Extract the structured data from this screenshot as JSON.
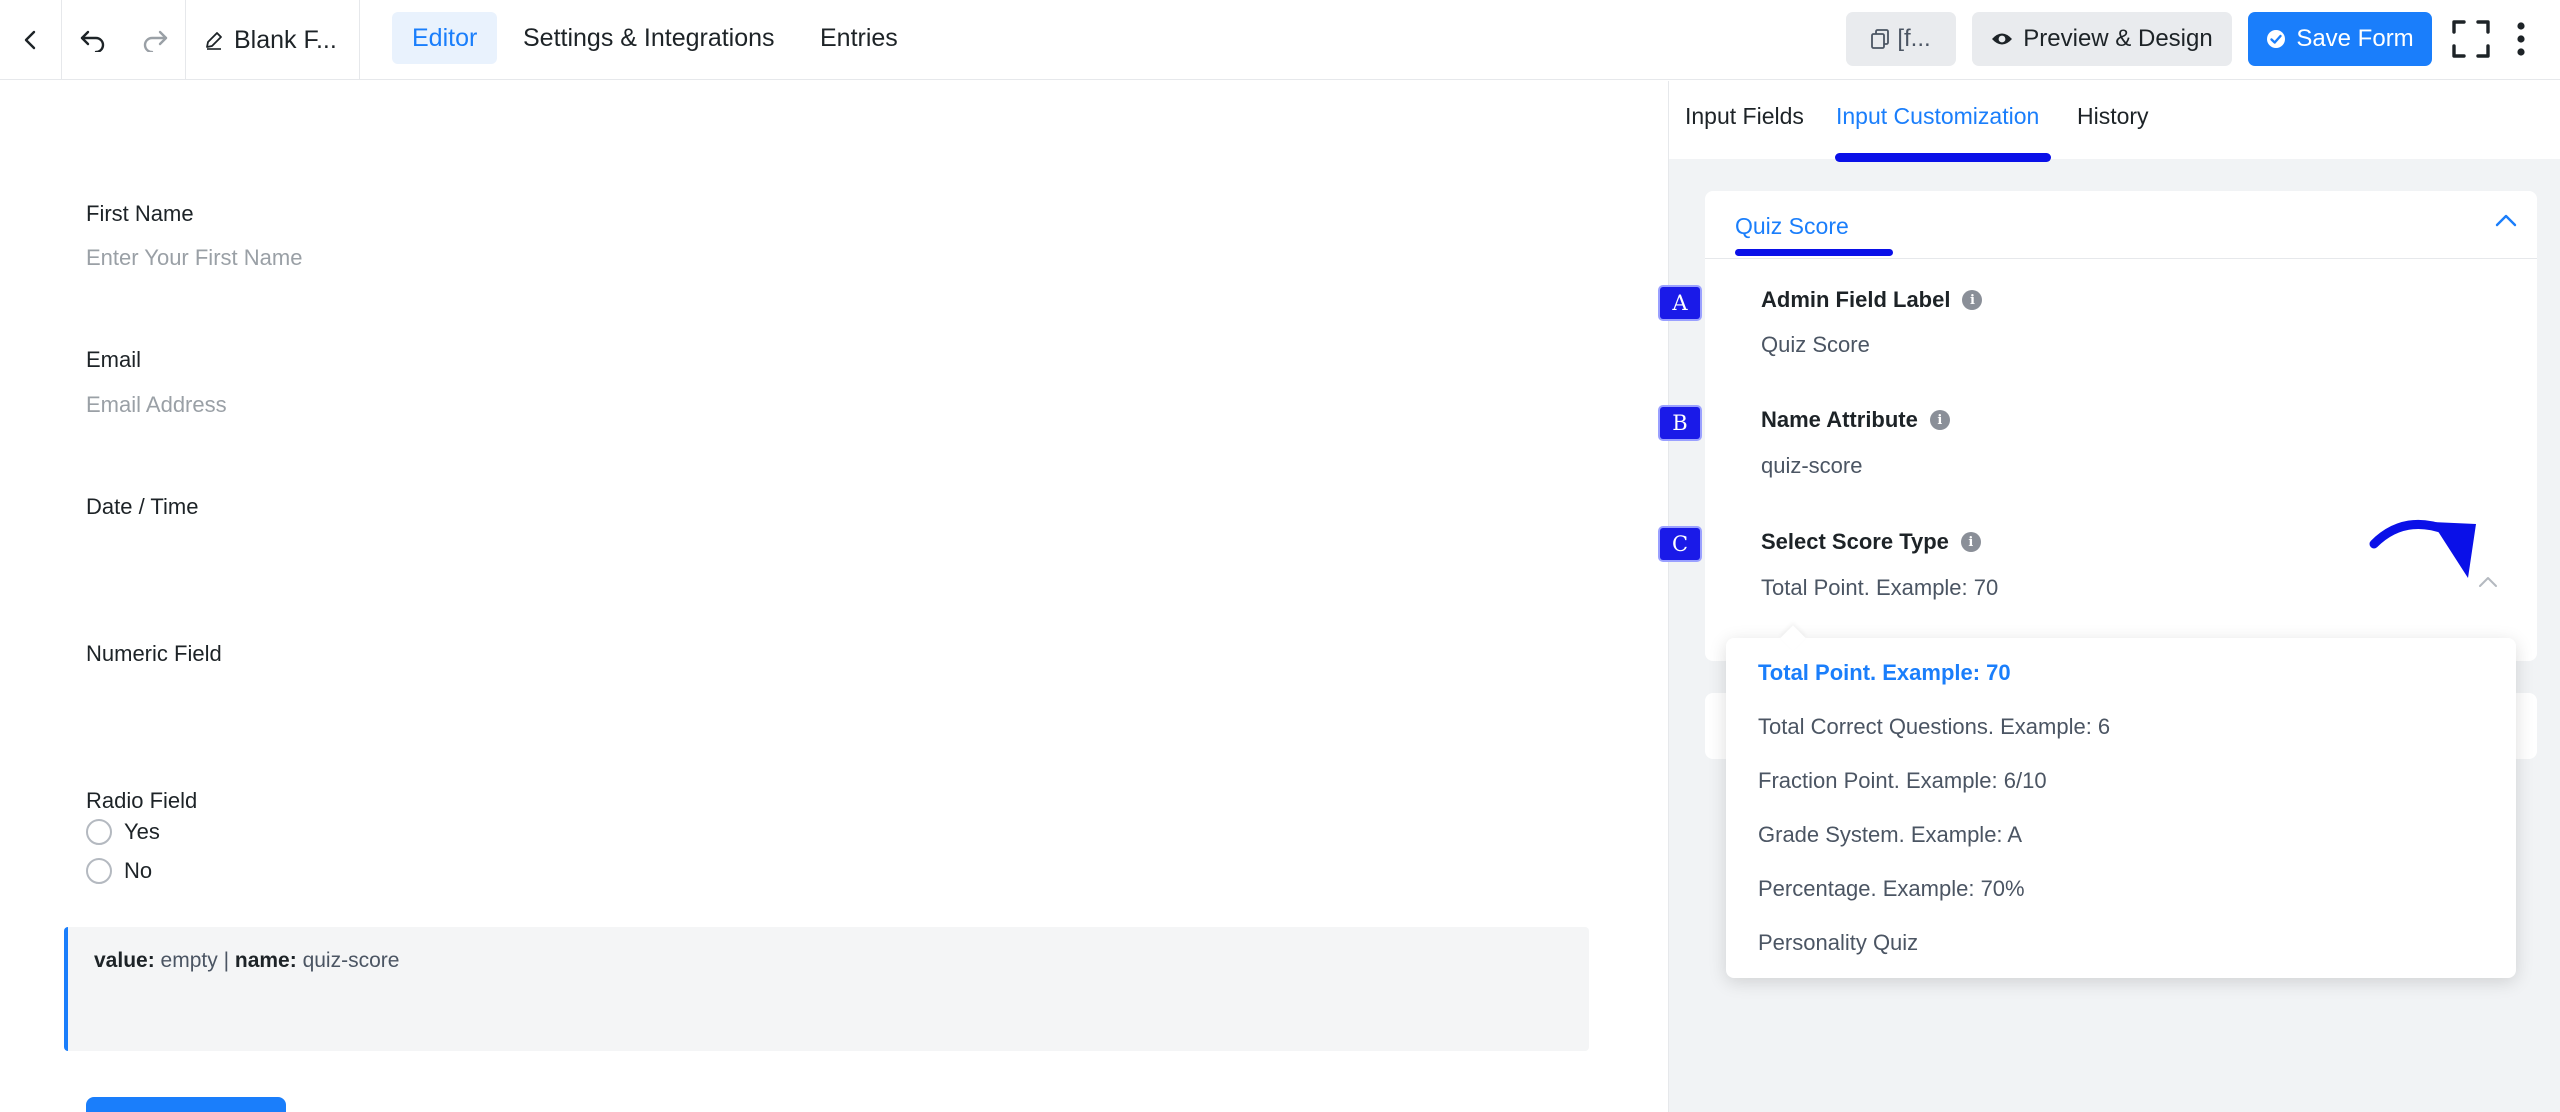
{
  "topbar": {
    "form_title": "Blank F...",
    "tabs": [
      {
        "label": "Editor",
        "active": true
      },
      {
        "label": "Settings & Integrations",
        "active": false
      },
      {
        "label": "Entries",
        "active": false
      }
    ],
    "shortcode_label": "[f...",
    "preview_label": "Preview & Design",
    "save_label": "Save Form"
  },
  "editor": {
    "fields": [
      {
        "label": "First Name",
        "placeholder": "Enter Your First Name"
      },
      {
        "label": "Email",
        "placeholder": "Email Address"
      },
      {
        "label": "Date / Time",
        "placeholder": ""
      },
      {
        "label": "Numeric Field",
        "placeholder": ""
      },
      {
        "label": "Radio Field",
        "placeholder": ""
      }
    ],
    "radio_options": [
      "Yes",
      "No"
    ],
    "info_box": {
      "value_key": "value:",
      "value_text": "empty |",
      "name_key": "name:",
      "name_text": "quiz-score"
    }
  },
  "sidebar": {
    "tabs": [
      {
        "label": "Input Fields",
        "active": false
      },
      {
        "label": "Input Customization",
        "active": true
      },
      {
        "label": "History",
        "active": false
      }
    ],
    "panel_title": "Quiz Score",
    "settings": [
      {
        "marker": "A",
        "label": "Admin Field Label",
        "value": "Quiz Score"
      },
      {
        "marker": "B",
        "label": "Name Attribute",
        "value": "quiz-score"
      },
      {
        "marker": "C",
        "label": "Select Score Type",
        "value": "Total Point. Example: 70"
      }
    ],
    "score_type_options": [
      {
        "label": "Total Point. Example: 70",
        "selected": true
      },
      {
        "label": "Total Correct Questions. Example: 6",
        "selected": false
      },
      {
        "label": "Fraction Point. Example: 6/10",
        "selected": false
      },
      {
        "label": "Grade System. Example: A",
        "selected": false
      },
      {
        "label": "Percentage. Example: 70%",
        "selected": false
      },
      {
        "label": "Personality Quiz",
        "selected": false
      }
    ]
  },
  "colors": {
    "accent": "#1a7efb",
    "annotation": "#0a10e8"
  }
}
